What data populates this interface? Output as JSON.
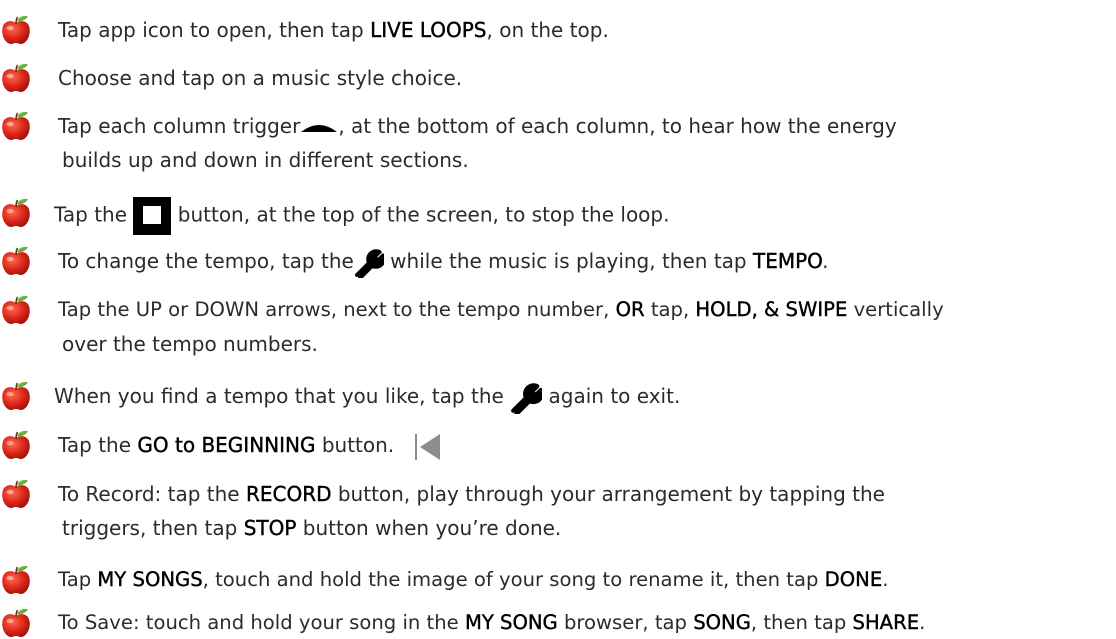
{
  "colors": {
    "text": "#2b2b2b",
    "apple_red": "#e0281c",
    "apple_leaf": "#6ab83a",
    "icon_black": "#000000",
    "rewind_gray": "#8c8c8c"
  },
  "icons": {
    "bullet": "apple-icon",
    "trigger": "column-trigger-icon",
    "stop": "stop-square-icon",
    "settings": "wrench-icon",
    "go_to_beginning": "go-to-beginning-icon"
  },
  "steps": [
    {
      "p1": "Tap app icon to open, then tap ",
      "b1": "LIVE LOOPS",
      "p2": ", on the top."
    },
    {
      "p1": "Choose and tap on a music style choice."
    },
    {
      "p1": "Tap each column trigger",
      "p2": ", at the bottom of each column, to hear how the energy",
      "l2": "builds up and down in different sections."
    },
    {
      "p1": "Tap the ",
      "p2": " button, at the top of the screen, to stop the loop."
    },
    {
      "p1": "To change the tempo, tap the",
      "p2": " while the music is playing, then tap ",
      "b1": "TEMPO",
      "p3": "."
    },
    {
      "p1": "Tap the UP or DOWN arrows, next to the tempo number, ",
      "b1": "OR",
      "p2": " tap, ",
      "b2": "HOLD, & SWIPE",
      "p3": " vertically",
      "l2": "over the tempo numbers."
    },
    {
      "p1": "When you find a tempo that you like, tap the ",
      "p2": "  again to exit."
    },
    {
      "p1": "Tap the ",
      "b1": "GO to BEGINNING",
      "p2": " button."
    },
    {
      "p1": "To Record: tap the ",
      "b1": "RECORD",
      "p2": " button, play through your arrangement by tapping the",
      "l2a": "triggers, then tap ",
      "b2": "STOP",
      "l2b": " button when you’re done."
    },
    {
      "p1": "Tap ",
      "b1": "MY SONGS",
      "p2": ", touch and hold the image of your song to rename it, then tap ",
      "b2": "DONE",
      "p3": "."
    },
    {
      "p1": "To Save: touch and hold your song in the ",
      "b1": "MY SONG",
      "p2": " browser, tap ",
      "b2": "SONG",
      "p3": ", then tap ",
      "b3": "SHARE",
      "p4": "."
    }
  ]
}
